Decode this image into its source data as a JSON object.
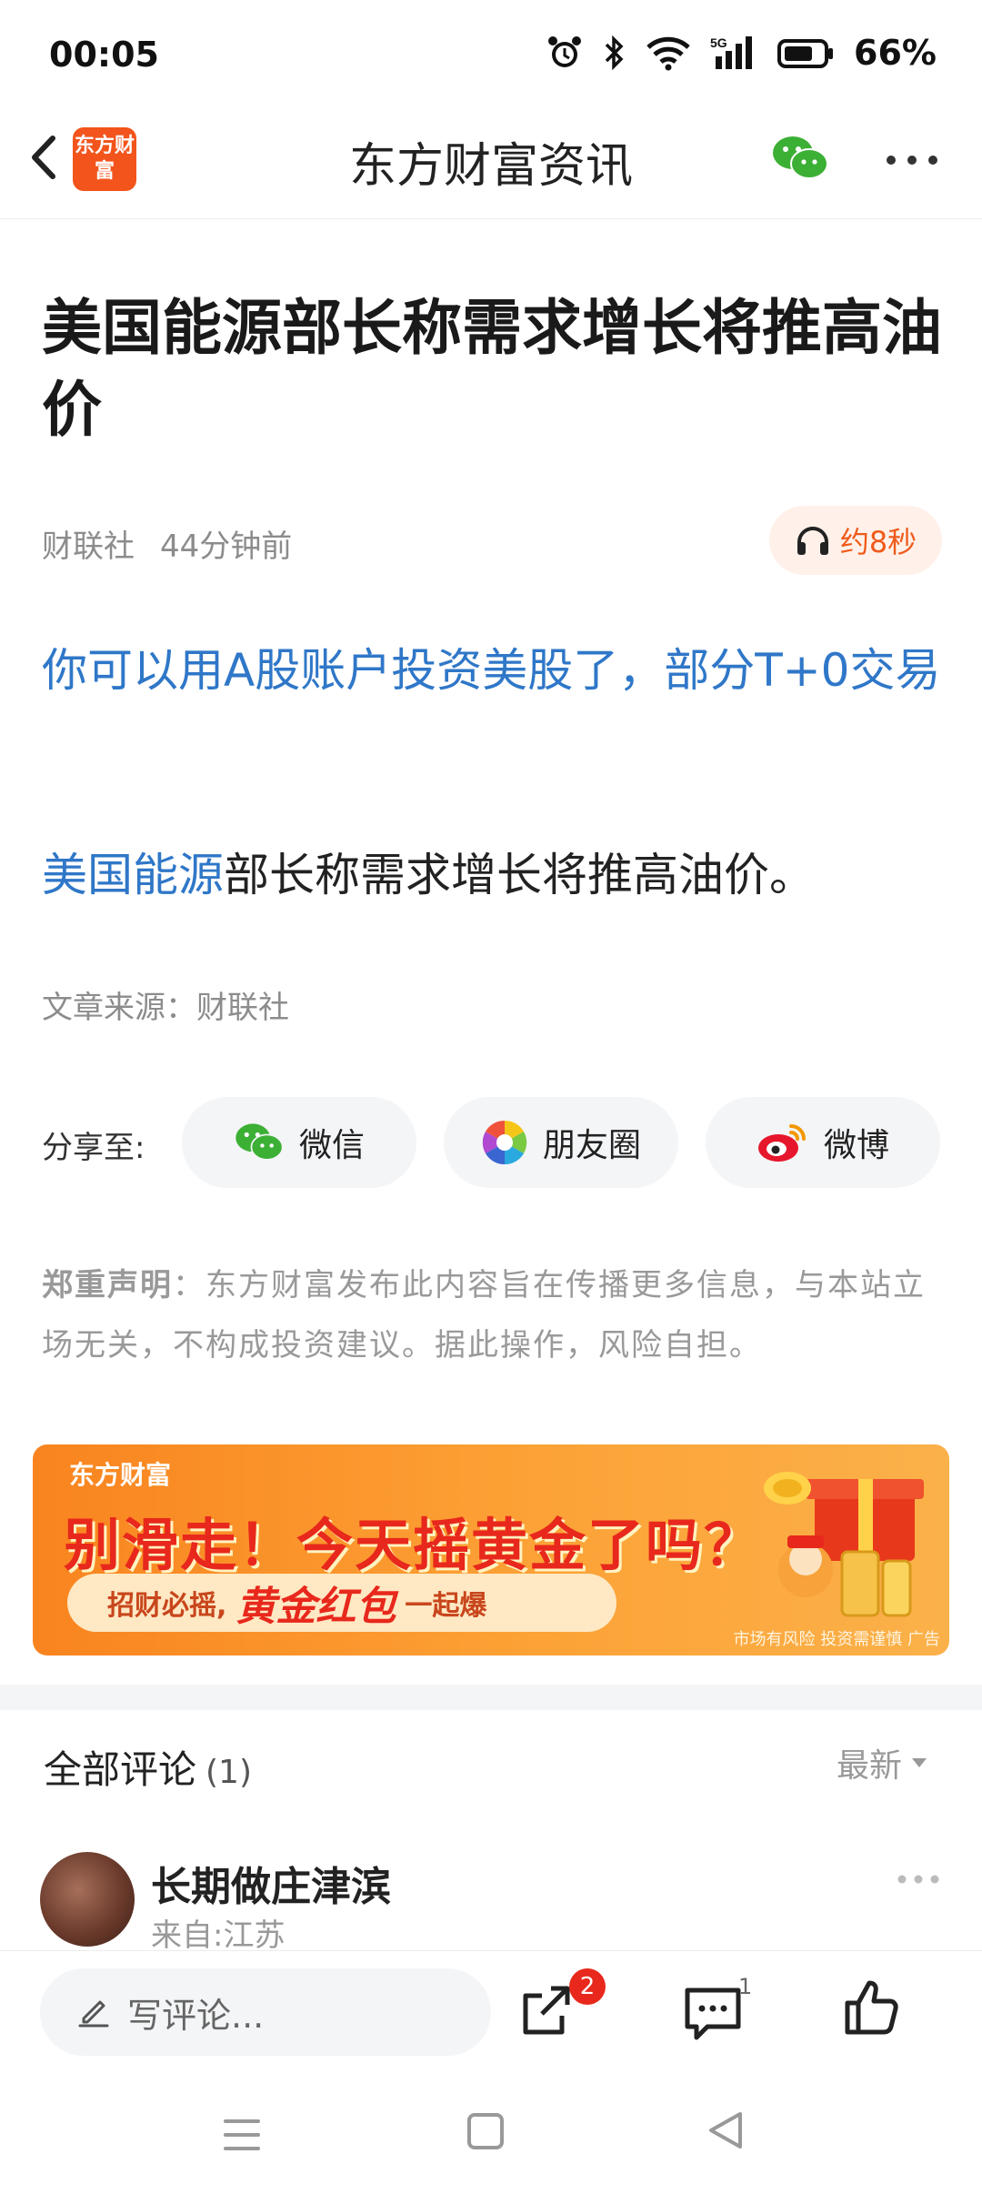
{
  "status_bar": {
    "time": "00:05",
    "battery": "66%",
    "network": "5G"
  },
  "header": {
    "title": "东方财富资讯",
    "logo_text": "东方财富"
  },
  "article": {
    "title": "美国能源部长称需求增长将推高油价",
    "source_name": "财联社",
    "time_ago": "44分钟前",
    "audio_duration": "约8秒",
    "promo_link": "你可以用A股账户投资美股了，部分T+0交易",
    "body_keyword": "美国能源",
    "body_rest": "部长称需求增长将推高油价。",
    "source_line": "文章来源：财联社"
  },
  "share": {
    "label": "分享至:",
    "options": [
      {
        "label": "微信",
        "icon": "wechat-icon"
      },
      {
        "label": "朋友圈",
        "icon": "moments-icon"
      },
      {
        "label": "微博",
        "icon": "weibo-icon"
      }
    ]
  },
  "disclaimer": {
    "heading": "郑重声明",
    "text": "：东方财富发布此内容旨在传播更多信息，与本站立场无关，不构成投资建议。据此操作，风险自担。"
  },
  "banner": {
    "brand": "东方财富",
    "headline": "别滑走！今天摇黄金了吗？",
    "cta_prefix": "招财必摇,",
    "cta_main": "黄金红包",
    "cta_suffix": "一起爆",
    "note": "市场有风险 投资需谨慎 广告"
  },
  "comments": {
    "title": "全部评论",
    "count": "(1)",
    "sort_label": "最新",
    "items": [
      {
        "user": "长期做庄津滨",
        "location": "来自:江苏"
      }
    ]
  },
  "bottom_bar": {
    "input_placeholder": "写评论...",
    "share_badge": "2",
    "comment_count": "1"
  },
  "colors": {
    "accent": "#f05a1a",
    "link": "#2f77c8",
    "badge": "#e8281c"
  }
}
